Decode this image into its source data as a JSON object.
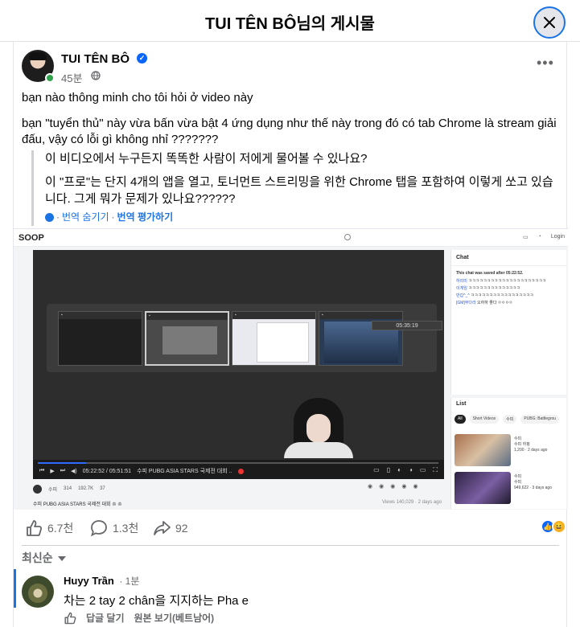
{
  "modal": {
    "title": "TUI TÊN BÔ님의 게시물"
  },
  "post": {
    "author": "TUI TÊN BÔ",
    "time": "45분",
    "text_line1": "bạn nào thông minh cho tôi hỏi ở video này",
    "text_line2": "bạn \"tuyển thủ\" này vừa bấn vừa bật 4 ứng dụng như thế này trong đó có tab Chrome là stream giải đấu, vậy có lỗi gì không nhỉ ???????",
    "translation_line1": "이 비디오에서 누구든지 똑똑한 사람이 저에게 물어볼 수 있나요?",
    "translation_line2": "이 \"프로\"는 단지 4개의 앱을 열고, 토너먼트 스트리밍을 위한 Chrome 탭을 포함하여 이렇게 쏘고 있습니다. 그게 뭐가 문제가 있나요??????",
    "hide_translation": "번역 숨기기",
    "rate_translation": "번역 평가하기"
  },
  "embed": {
    "logo": "SOOP",
    "login": "Login",
    "clock": "05:35:19",
    "progress": 0.12,
    "player_time": "05:22:52 / 05:51:51",
    "player_title": "수피 PUBG ASIA STARS 국제전 대회 ..",
    "meta_user": "수피",
    "meta_stat1": "314",
    "meta_stat2": "192.7K",
    "meta_stat3": "37",
    "video_title": "수피 PUBG ASIA STARS 국제전 대회 ♔ ♔",
    "views": "Views 140,029 · 2 days ago",
    "chat_title": "Chat",
    "chat_saved": "This chat was saved after 05:22:52.",
    "chat_lines": [
      {
        "user": "하리미",
        "msg": "ㅋㅋㅋㅋㅋㅋㅋㅋㅋㅋㅋㅋㅋㅋㅋㅋㅋㅋㅋㅋㅋ"
      },
      {
        "user": "이게임",
        "msg": "ㅋㅋㅋㅋㅋㅋㅋㅋㅋㅋㅋㅋㅋㅋ"
      },
      {
        "user": "반갑^_^",
        "msg": "ㅋㅋㅋㅋㅋㅋㅋㅋㅋㅋㅋㅋㅋㅋㅋㅋㅋ"
      },
      {
        "user": "[GM]무다라",
        "msg": "오하하 좋다 ㅇㅇㅇㅇ"
      }
    ],
    "list_title": "List",
    "list_tabs": [
      "All",
      "Short Videos",
      "수피",
      "PUBG: Battlegrou"
    ],
    "list_items": [
      {
        "name": "수피",
        "sub": "수피 하핑",
        "meta": "1,200 · 2 days ago"
      },
      {
        "name": "수피",
        "sub": "수피",
        "meta": "949,622 · 3 days ago"
      }
    ]
  },
  "stats": {
    "likes": "6.7천",
    "comments": "1.3천",
    "shares": "92"
  },
  "comments": {
    "sort_label": "최신순",
    "items": [
      {
        "name": "Huyy Trần",
        "time": "· 1분",
        "text": "차는 2 tay 2 chân을 지지하는 Pha e",
        "reply": "답글 달기",
        "see_original": "원본 보기(베트남어)"
      }
    ]
  },
  "colors": {
    "accent": "#1b74e4",
    "online": "#31a24c"
  }
}
